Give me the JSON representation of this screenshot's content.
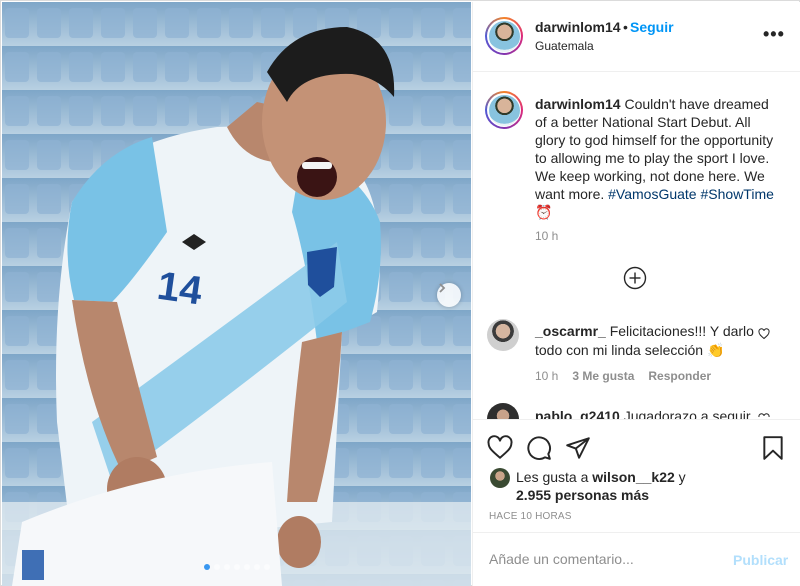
{
  "post": {
    "username": "darwinlom14",
    "separator": "•",
    "follow_label": "Seguir",
    "location": "Guatemala",
    "more_label": "•••",
    "caption_text": "Couldn't have dreamed of a better National Start Debut. All glory to god himself for the opportunity to allowing me to play the sport I love. We keep working, not done here. We want more.",
    "hashtag_1": "#VamosGuate",
    "hashtag_2": "#ShowTime",
    "caption_emoji": "⏰",
    "caption_time": "10 h",
    "carousel": {
      "slides": 7,
      "active_index": 0
    }
  },
  "comments": [
    {
      "username": "_oscarmr_",
      "text": "Felicitaciones!!! Y darlo todo con mi linda selección",
      "emoji": "👏",
      "time": "10 h",
      "likes": "3 Me gusta",
      "reply_label": "Responder"
    },
    {
      "username": "pablo_g2410",
      "text": "Jugadorazo a seguir"
    }
  ],
  "likes": {
    "prefix": "Les gusta a",
    "user": "wilson__k22",
    "conj": "y",
    "count": "2.955 personas más"
  },
  "post_time": "HACE 10 HORAS",
  "comment_box": {
    "placeholder": "Añade un comentario...",
    "publish_label": "Publicar"
  },
  "colors": {
    "link": "#0095f6",
    "hashtag": "#00376b",
    "muted": "#8e8e8e",
    "publish_disabled": "#b2dffc",
    "carousel_active": "#3897f0"
  },
  "icons": [
    "more-options-icon",
    "load-more-comments-icon",
    "heart-icon",
    "comment-icon",
    "share-icon",
    "bookmark-icon",
    "carousel-next-icon"
  ]
}
